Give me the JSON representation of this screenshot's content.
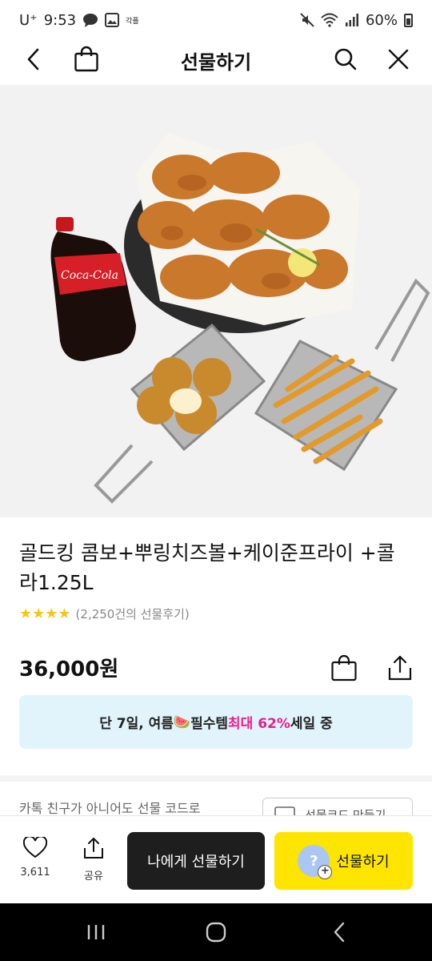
{
  "status_bar": {
    "carrier": "U⁺",
    "time": "9:53",
    "small_label": "각플",
    "battery": "60%"
  },
  "header": {
    "title": "선물하기"
  },
  "product": {
    "title": "골드킹 콤보+뿌링치즈볼+케이준프라이 +콜라1.25L",
    "rating_stars": "★★★★",
    "review_text": "(2,250건의 선물후기)",
    "price": "36,000원"
  },
  "promo": {
    "text_before": "단 7일, 여름",
    "emoji": "🍉",
    "text_middle": "필수템 ",
    "highlight": "최대 62%",
    "text_after": "세일 중"
  },
  "gift_code": {
    "text": "카톡 친구가 아니어도 선물 코드로",
    "button_label": "선물코드 만들기"
  },
  "action_bar": {
    "like_count": "3,611",
    "share_label": "공유",
    "self_gift_label": "나에게 선물하기",
    "gift_label": "선물하기",
    "avatar_glyph": "?",
    "plus_glyph": "+"
  },
  "colors": {
    "gift_button": "#fee500",
    "self_button": "#1e1e1e",
    "promo_bg": "#e1f3fb",
    "promo_highlight": "#e91e8c",
    "star": "#f5c518"
  }
}
